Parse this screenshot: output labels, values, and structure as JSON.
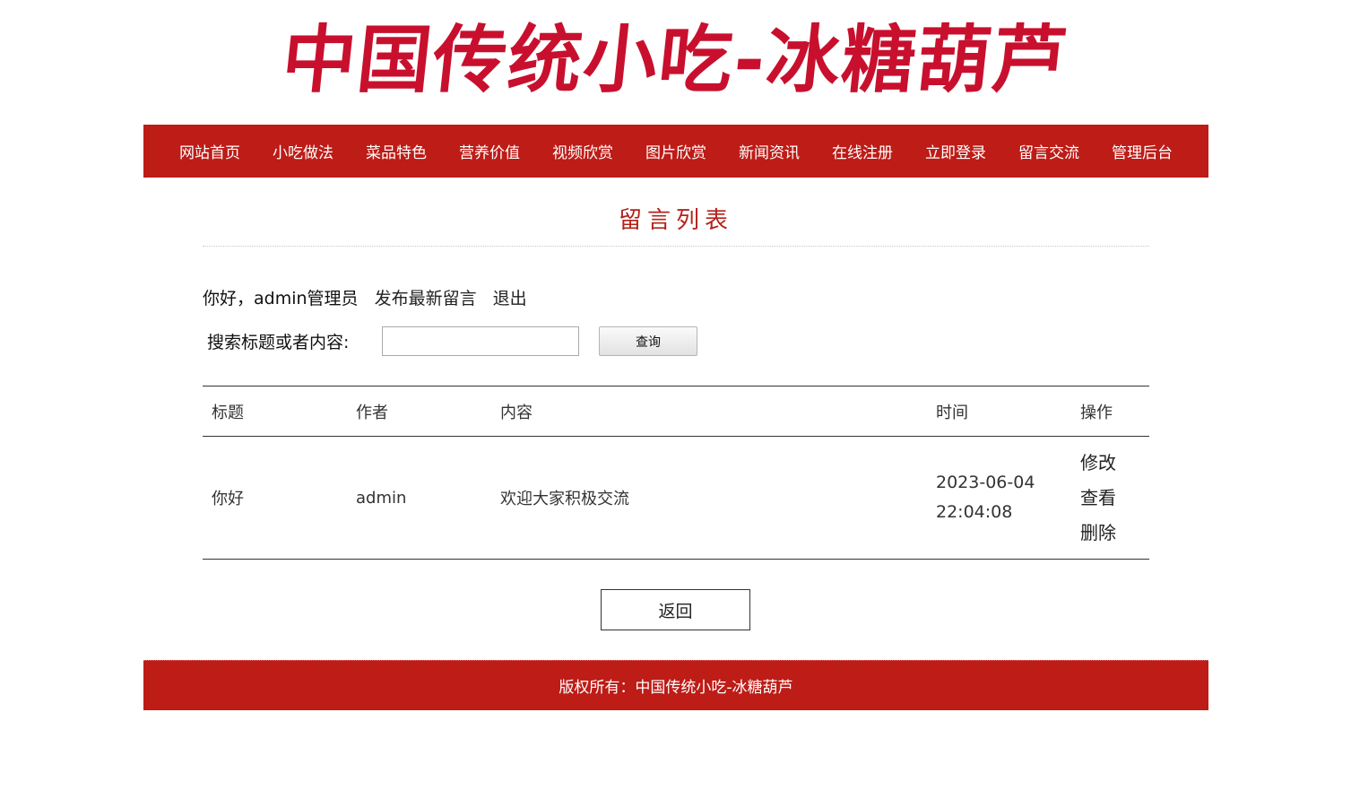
{
  "site": {
    "banner_title": "中国传统小吃-冰糖葫芦",
    "brand_color": "#bd1c17",
    "title_color": "#c8102e"
  },
  "nav": {
    "items": [
      "网站首页",
      "小吃做法",
      "菜品特色",
      "营养价值",
      "视频欣赏",
      "图片欣赏",
      "新闻资讯",
      "在线注册",
      "立即登录",
      "留言交流",
      "管理后台"
    ]
  },
  "page": {
    "section_title": "留言列表",
    "greeting": "你好，admin管理员",
    "post_link": "发布最新留言",
    "logout_link": "退出",
    "search_label": "搜索标题或者内容:",
    "search_value": "",
    "search_button": "查询",
    "back_button": "返回"
  },
  "table": {
    "headers": [
      "标题",
      "作者",
      "内容",
      "时间",
      "操作"
    ],
    "rows": [
      {
        "title": "你好",
        "author": "admin",
        "content": "欢迎大家积极交流",
        "date": "2023-06-04",
        "time": "22:04:08",
        "ops": [
          "修改",
          "查看",
          "删除"
        ]
      }
    ]
  },
  "footer": {
    "text": "版权所有：中国传统小吃-冰糖葫芦"
  }
}
